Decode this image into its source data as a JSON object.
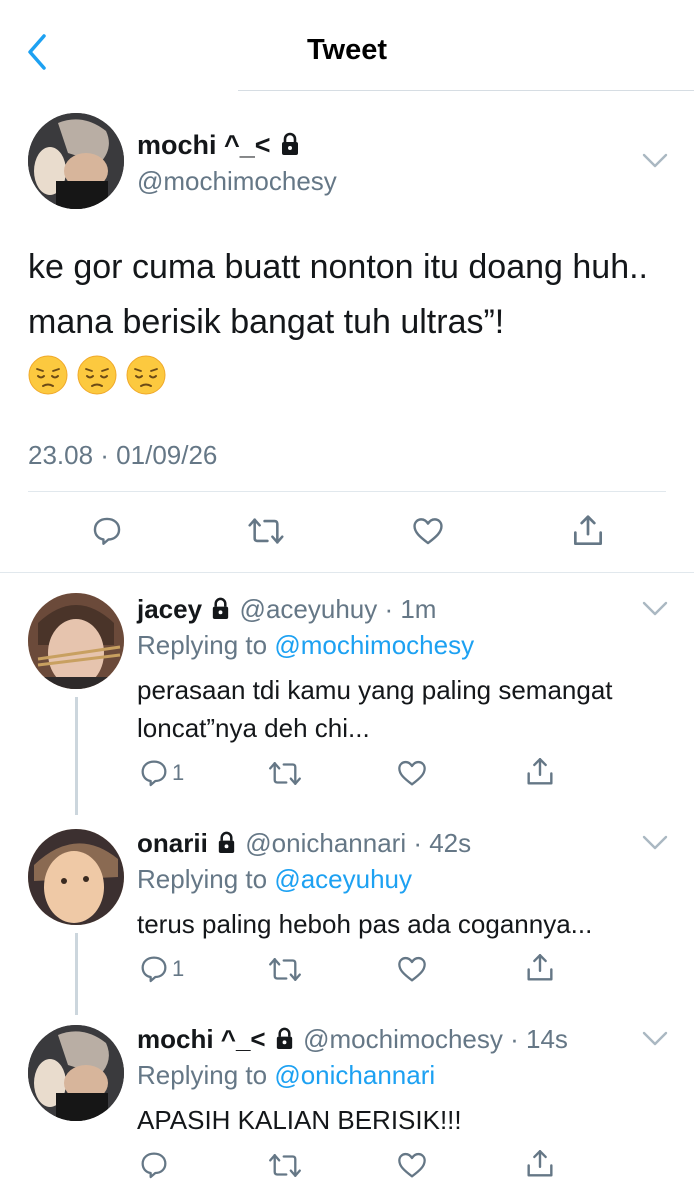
{
  "header": {
    "title": "Tweet",
    "back_icon": "chevron-left-icon",
    "accent_color": "#1da1f2"
  },
  "main_tweet": {
    "display_name": "mochi ^_<",
    "handle": "@mochimochesy",
    "protected": true,
    "text": "ke gor cuma buatt nonton itu doang huh.. mana berisik bangat tuh ultras”!",
    "emoji": [
      "pensive-face",
      "pensive-face",
      "pensive-face"
    ],
    "timestamp": "23.08 · 01/09/26",
    "actions": [
      "reply-icon",
      "retweet-icon",
      "like-icon",
      "share-icon"
    ]
  },
  "replies": [
    {
      "display_name": "jacey",
      "handle_time": "@aceyuhuy · 1m",
      "replying_prefix": "Replying to",
      "replying_to": "@mochimochesy",
      "text": "perasaan tdi kamu yang paling semangat loncat”nya deh chi...",
      "reply_count": "1"
    },
    {
      "display_name": "onarii",
      "handle_time": "@onichannari · 42s",
      "replying_prefix": "Replying to",
      "replying_to": "@aceyuhuy",
      "text": "terus paling heboh pas ada cogannya...",
      "reply_count": "1"
    },
    {
      "display_name": "mochi ^_<",
      "handle_time": "@mochimochesy · 14s",
      "replying_prefix": "Replying to",
      "replying_to": "@onichannari",
      "text": "APASIH KALIAN BERISIK!!!",
      "reply_count": ""
    }
  ]
}
